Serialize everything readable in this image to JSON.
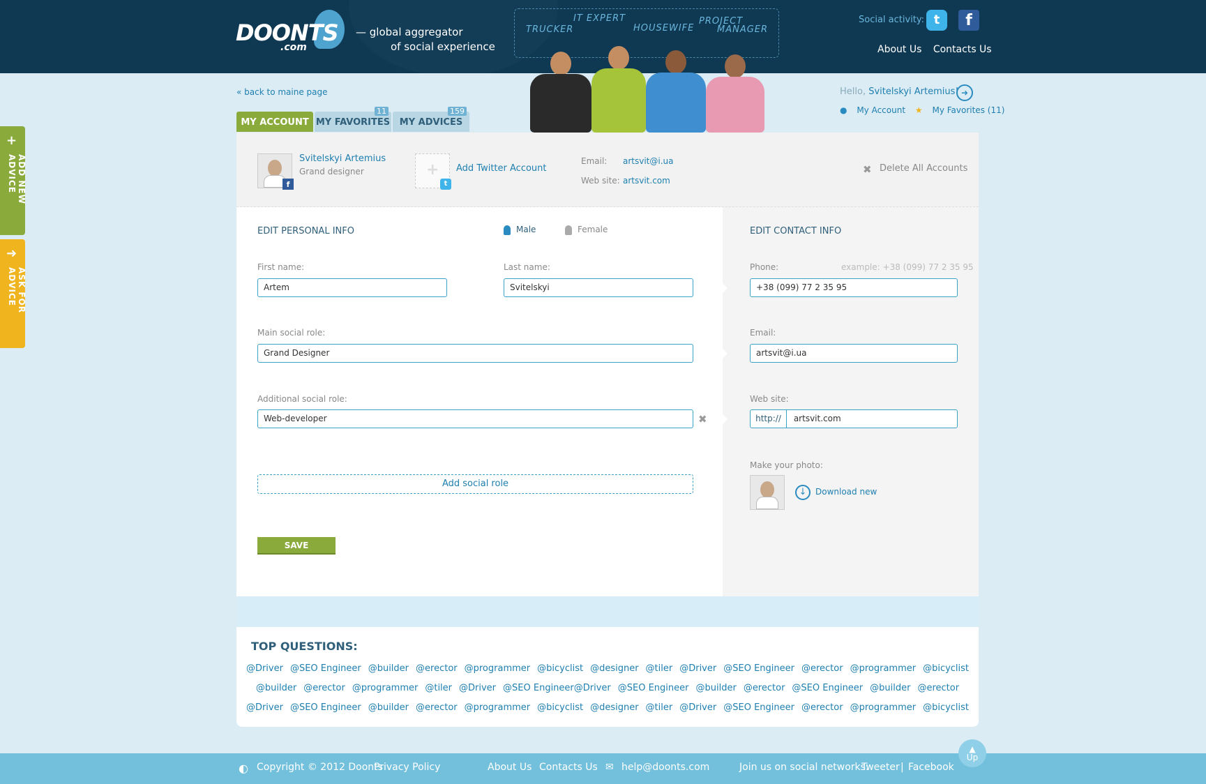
{
  "header": {
    "logo_main": "DOONTS",
    "logo_com": ".com",
    "tagline_line1": "— global aggregator",
    "tagline_line2": "of social experience",
    "roles": [
      "TRUCKER",
      "IT EXPERT",
      "HOUSEWIFE",
      "PROJECT",
      "MANAGER"
    ],
    "social_label": "Social activity:",
    "twitter_glyph": "t",
    "facebook_glyph": "f",
    "links": [
      "About Us",
      "Contacts Us"
    ]
  },
  "nav": {
    "back_link": "« back to maine page",
    "hello_prefix": "Hello,",
    "user_name": "Svitelskyi Artemius!",
    "my_account": "My Account",
    "my_favorites": "My Favorites (11)"
  },
  "tabs": [
    {
      "label": "MY ACCOUNT"
    },
    {
      "label": "MY FAVORITES",
      "count": "11"
    },
    {
      "label": "MY ADVICES",
      "count": "159"
    }
  ],
  "profile": {
    "name": "Svitelskyi Artemius",
    "title": "Grand designer",
    "fb_glyph": "f",
    "tw_glyph": "t",
    "add_twitter": "Add Twitter Account",
    "email_label": "Email:",
    "email": "artsvit@i.ua",
    "website_label": "Web site:",
    "website": "artsvit.com",
    "delete_all": "Delete All Accounts"
  },
  "personal": {
    "title": "EDIT PERSONAL INFO",
    "gender_male": "Male",
    "gender_female": "Female",
    "first_name_label": "First name:",
    "first_name": "Artem",
    "last_name_label": "Last name:",
    "last_name": "Svitelskyi",
    "main_role_label": "Main social role:",
    "main_role": "Grand Designer",
    "add_role_label": "Additional social role:",
    "add_role": "Web-developer",
    "add_social_role": "Add social role",
    "save": "SAVE"
  },
  "contact": {
    "title": "EDIT CONTACT INFO",
    "phone_label": "Phone:",
    "phone_example": "example: +38 (099) 77 2 35 95",
    "phone": "+38 (099) 77 2 35 95",
    "email_label": "Email:",
    "email": "artsvit@i.ua",
    "website_label": "Web site:",
    "website_prefix": "http://",
    "website": "artsvit.com",
    "photo_label": "Make your photo:",
    "download": "Download new"
  },
  "side_tabs": {
    "add_advice": "ADD NEW ADVICE",
    "ask_advice": "ASK FOR ADVICE"
  },
  "questions": {
    "title": "TOP QUESTIONS:",
    "rows": [
      [
        "@Driver",
        "@SEO Engineer",
        "@builder",
        "@erector",
        "@programmer",
        "@bicyclist",
        "@designer",
        "@tiler",
        "@Driver",
        "@SEO Engineer",
        "@erector",
        "@programmer",
        "@bicyclist"
      ],
      [
        "@builder",
        "@erector",
        "@programmer",
        "@tiler",
        "@Driver",
        "@SEO Engineer@Driver",
        "@SEO Engineer",
        "@builder",
        "@erector",
        "@SEO Engineer",
        "@builder",
        "@erector"
      ],
      [
        "@Driver",
        "@SEO Engineer",
        "@builder",
        "@erector",
        "@programmer",
        "@bicyclist",
        "@designer",
        "@tiler",
        "@Driver",
        "@SEO Engineer",
        "@erector",
        "@programmer",
        "@bicyclist"
      ]
    ]
  },
  "footer": {
    "copyright": "Copyright © 2012 Doonts",
    "privacy": "Privacy Policy",
    "about": "About Us",
    "contacts": "Contacts Us",
    "email": "help@doonts.com",
    "join": "Join us on social networks:",
    "tweeter": "Tweeter",
    "separator": "|",
    "facebook": "Facebook",
    "up": "Up"
  },
  "colors": {
    "header_bg": "#0f3952",
    "accent_green": "#8aaa3c",
    "accent_orange": "#f0b41e",
    "link_blue": "#1e7fb0",
    "field_border": "#3aa2c8"
  }
}
